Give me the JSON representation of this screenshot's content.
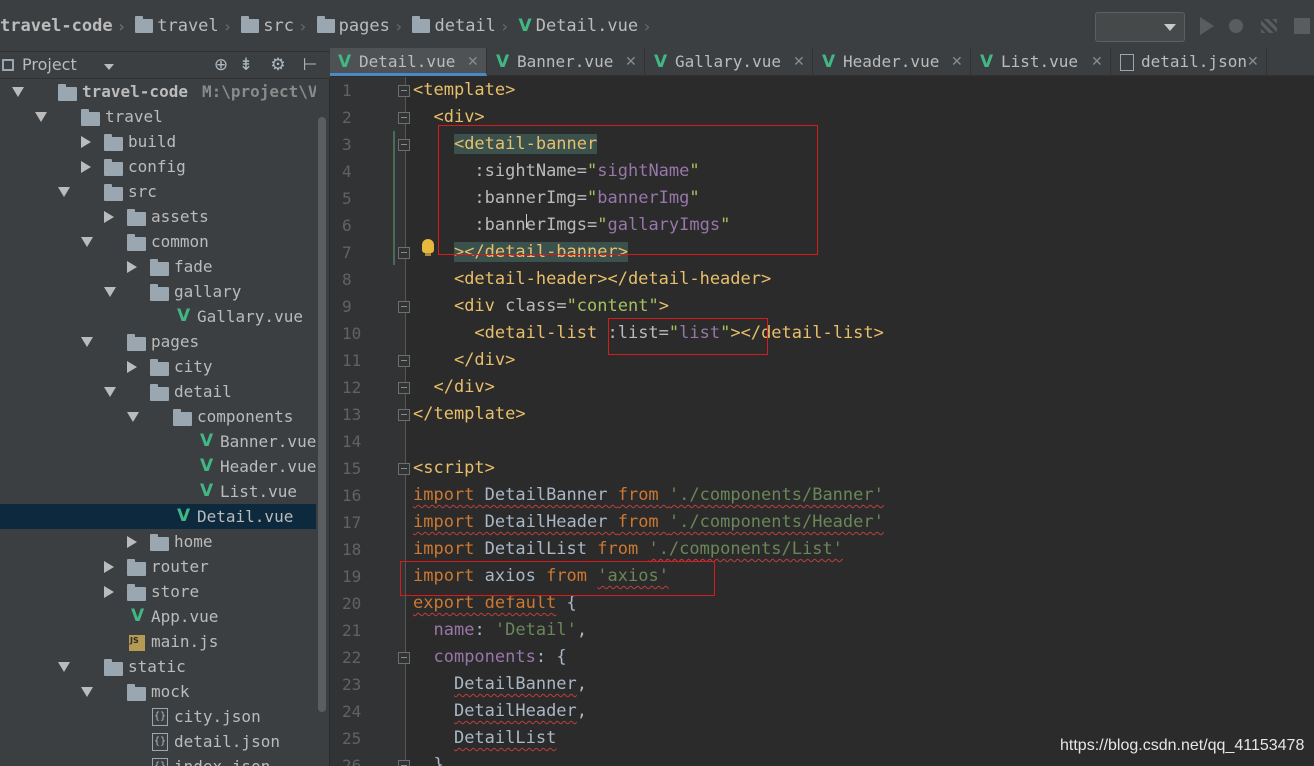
{
  "breadcrumb": [
    {
      "label": "travel-code",
      "icon": "folder-icon"
    },
    {
      "label": "travel",
      "icon": "folder-icon"
    },
    {
      "label": "src",
      "icon": "folder-icon"
    },
    {
      "label": "pages",
      "icon": "folder-icon"
    },
    {
      "label": "detail",
      "icon": "folder-icon"
    },
    {
      "label": "Detail.vue",
      "icon": "vue-icon"
    }
  ],
  "toolbar": {
    "run_config_value": "",
    "run_icon": "run-icon",
    "debug_icon": "debug-icon",
    "coverage_icon": "coverage-icon",
    "stop_icon": "stop-icon"
  },
  "project_panel": {
    "title": "Project",
    "header_icons": [
      "locate-icon",
      "collapse-icon",
      "settings-icon",
      "hide-icon"
    ]
  },
  "tree": [
    {
      "label": "travel-code",
      "path": "M:\\project\\Vuetra",
      "kind": "folder",
      "depth": 0,
      "state": "open",
      "bold": true
    },
    {
      "label": "travel",
      "kind": "folder",
      "depth": 1,
      "state": "open"
    },
    {
      "label": "build",
      "kind": "folder",
      "depth": 2,
      "state": "closed"
    },
    {
      "label": "config",
      "kind": "folder",
      "depth": 2,
      "state": "closed"
    },
    {
      "label": "src",
      "kind": "folder",
      "depth": 2,
      "state": "open"
    },
    {
      "label": "assets",
      "kind": "folder",
      "depth": 3,
      "state": "closed"
    },
    {
      "label": "common",
      "kind": "folder",
      "depth": 3,
      "state": "open"
    },
    {
      "label": "fade",
      "kind": "folder",
      "depth": 4,
      "state": "closed"
    },
    {
      "label": "gallary",
      "kind": "folder",
      "depth": 4,
      "state": "open"
    },
    {
      "label": "Gallary.vue",
      "kind": "vue",
      "depth": 5
    },
    {
      "label": "pages",
      "kind": "folder",
      "depth": 3,
      "state": "open"
    },
    {
      "label": "city",
      "kind": "folder",
      "depth": 4,
      "state": "closed"
    },
    {
      "label": "detail",
      "kind": "folder",
      "depth": 4,
      "state": "open"
    },
    {
      "label": "components",
      "kind": "folder",
      "depth": 5,
      "state": "open"
    },
    {
      "label": "Banner.vue",
      "kind": "vue",
      "depth": 6
    },
    {
      "label": "Header.vue",
      "kind": "vue",
      "depth": 6
    },
    {
      "label": "List.vue",
      "kind": "vue",
      "depth": 6
    },
    {
      "label": "Detail.vue",
      "kind": "vue",
      "depth": 5,
      "selected": true
    },
    {
      "label": "home",
      "kind": "folder",
      "depth": 4,
      "state": "closed"
    },
    {
      "label": "router",
      "kind": "folder",
      "depth": 3,
      "state": "closed"
    },
    {
      "label": "store",
      "kind": "folder",
      "depth": 3,
      "state": "closed"
    },
    {
      "label": "App.vue",
      "kind": "vue",
      "depth": 3
    },
    {
      "label": "main.js",
      "kind": "js",
      "depth": 3
    },
    {
      "label": "static",
      "kind": "folder",
      "depth": 2,
      "state": "open"
    },
    {
      "label": "mock",
      "kind": "folder",
      "depth": 3,
      "state": "open"
    },
    {
      "label": "city.json",
      "kind": "json",
      "depth": 4
    },
    {
      "label": "detail.json",
      "kind": "json",
      "depth": 4
    },
    {
      "label": "index.json",
      "kind": "json",
      "depth": 4
    }
  ],
  "tabs": [
    {
      "label": "Detail.vue",
      "icon": "vue-icon",
      "active": true
    },
    {
      "label": "Banner.vue",
      "icon": "vue-icon"
    },
    {
      "label": "Gallary.vue",
      "icon": "vue-icon"
    },
    {
      "label": "Header.vue",
      "icon": "vue-icon"
    },
    {
      "label": "List.vue",
      "icon": "vue-icon"
    },
    {
      "label": "detail.json",
      "icon": "json-file-icon"
    }
  ],
  "editor": {
    "lines": [
      [
        [
          "tg",
          "<template>"
        ]
      ],
      [
        [
          "",
          "  "
        ],
        [
          "tg",
          "<div>"
        ]
      ],
      [
        [
          "",
          "    "
        ],
        [
          "tg hl-tag",
          "<detail-banner"
        ]
      ],
      [
        [
          "",
          "      "
        ],
        [
          "at",
          ":sightName="
        ],
        [
          "av",
          "\""
        ],
        [
          "avp",
          "sightName"
        ],
        [
          "av",
          "\""
        ]
      ],
      [
        [
          "",
          "      "
        ],
        [
          "at",
          ":bannerImg="
        ],
        [
          "av",
          "\""
        ],
        [
          "avp",
          "bannerImg"
        ],
        [
          "av",
          "\""
        ]
      ],
      [
        [
          "",
          "      "
        ],
        [
          "at",
          ":bannerImgs="
        ],
        [
          "av",
          "\""
        ],
        [
          "avp",
          "gallaryImgs"
        ],
        [
          "av",
          "\""
        ]
      ],
      [
        [
          "",
          "    "
        ],
        [
          "tg hl-tag",
          "></detail-banner>"
        ]
      ],
      [
        [
          "",
          "    "
        ],
        [
          "tg",
          "<detail-header></detail-header>"
        ]
      ],
      [
        [
          "",
          "    "
        ],
        [
          "tg",
          "<div "
        ],
        [
          "at",
          "class="
        ],
        [
          "av",
          "\"content\""
        ],
        [
          "tg",
          ">"
        ]
      ],
      [
        [
          "",
          "      "
        ],
        [
          "tg",
          "<detail-list "
        ],
        [
          "at",
          ":list="
        ],
        [
          "av",
          "\""
        ],
        [
          "avp",
          "list"
        ],
        [
          "av",
          "\""
        ],
        [
          "tg",
          "></detail-list>"
        ]
      ],
      [
        [
          "",
          "    "
        ],
        [
          "tg",
          "</div>"
        ]
      ],
      [
        [
          "",
          "  "
        ],
        [
          "tg",
          "</div>"
        ]
      ],
      [
        [
          "tg",
          "</template>"
        ]
      ],
      [
        [
          "",
          ""
        ]
      ],
      [
        [
          "tg",
          "<script>"
        ]
      ],
      [
        [
          "kw squig",
          "import"
        ],
        [
          "ident squig",
          " DetailBanner "
        ],
        [
          "kw squig",
          "from"
        ],
        [
          "ident squig",
          " "
        ],
        [
          "str squig",
          "'./components/Banner'"
        ]
      ],
      [
        [
          "kw squig",
          "import"
        ],
        [
          "ident squig",
          " DetailHeader "
        ],
        [
          "kw squig",
          "from"
        ],
        [
          "ident squig",
          " "
        ],
        [
          "str squig",
          "'./components/Header'"
        ]
      ],
      [
        [
          "kw",
          "import"
        ],
        [
          "ident",
          " DetailList "
        ],
        [
          "kw",
          "from"
        ],
        [
          "ident",
          " "
        ],
        [
          "str squig",
          "'./components/List'"
        ]
      ],
      [
        [
          "kw",
          "import"
        ],
        [
          "ident",
          " axios "
        ],
        [
          "kw",
          "from"
        ],
        [
          "ident",
          " "
        ],
        [
          "str squig",
          "'axios'"
        ]
      ],
      [
        [
          "kw squig",
          "export default"
        ],
        [
          "ident",
          " {"
        ]
      ],
      [
        [
          "ident",
          "  "
        ],
        [
          "fld",
          "name"
        ],
        [
          "ident",
          ": "
        ],
        [
          "str",
          "'Detail'"
        ],
        [
          "ident",
          ","
        ]
      ],
      [
        [
          "ident",
          "  "
        ],
        [
          "fld",
          "components"
        ],
        [
          "ident",
          ": {"
        ]
      ],
      [
        [
          "ident",
          "    "
        ],
        [
          "ident squig",
          "DetailBanner"
        ],
        [
          "ident",
          ","
        ]
      ],
      [
        [
          "ident",
          "    "
        ],
        [
          "ident squig",
          "DetailHeader"
        ],
        [
          "ident",
          ","
        ]
      ],
      [
        [
          "ident",
          "    "
        ],
        [
          "ident squig",
          "DetailList"
        ]
      ],
      [
        [
          "ident",
          "  },"
        ]
      ]
    ],
    "line_numbers": [
      "1",
      "2",
      "3",
      "4",
      "5",
      "6",
      "7",
      "8",
      "9",
      "10",
      "11",
      "12",
      "13",
      "14",
      "15",
      "16",
      "17",
      "18",
      "19",
      "20",
      "21",
      "22",
      "23",
      "24",
      "25",
      "26"
    ],
    "fold_lines": [
      1,
      2,
      3,
      7,
      9,
      11,
      12,
      13,
      15,
      22,
      26
    ],
    "gutter_icons": [
      "lightbulb-icon"
    ]
  },
  "watermark": "https://blog.csdn.net/qq_41153478",
  "colors": {
    "tag": "#e8bf6a",
    "keyword": "#cc7832",
    "string": "#6a8759",
    "field": "#9876aa",
    "annotation_box": "#d51b1b",
    "selection": "#0d293e",
    "vue_green": "#41b883"
  }
}
